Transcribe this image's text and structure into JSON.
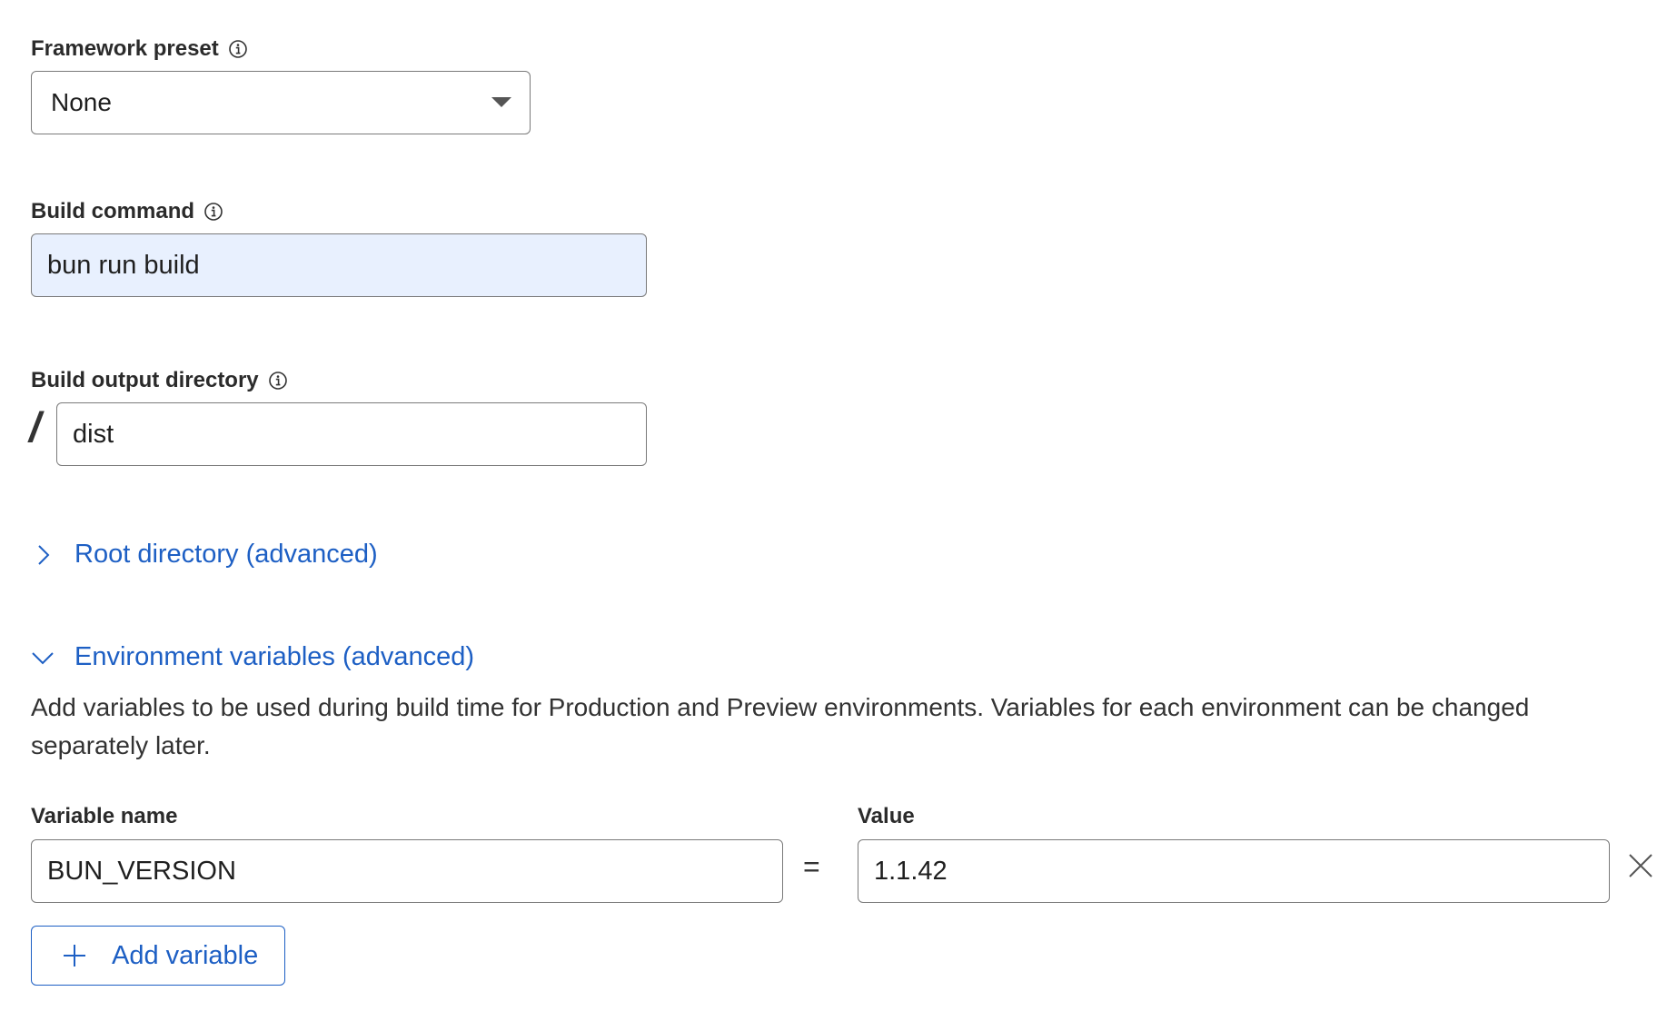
{
  "framework_preset": {
    "label": "Framework preset",
    "selected": "None"
  },
  "build_command": {
    "label": "Build command",
    "value": "bun run build"
  },
  "build_output_directory": {
    "label": "Build output directory",
    "prefix": "/",
    "value": "dist"
  },
  "root_directory": {
    "label": "Root directory (advanced)",
    "expanded": false
  },
  "environment_variables": {
    "label": "Environment variables (advanced)",
    "expanded": true,
    "description": "Add variables to be used during build time for Production and Preview environments. Variables for each environment can be changed separately later.",
    "name_column_label": "Variable name",
    "value_column_label": "Value",
    "separator": "=",
    "rows": [
      {
        "name": "BUN_VERSION",
        "value": "1.1.42"
      }
    ],
    "add_button_label": "Add variable"
  },
  "colors": {
    "link_blue": "#1d5fc4",
    "autofill_background": "#e8f0fe",
    "border_gray": "#7a7a7a"
  }
}
